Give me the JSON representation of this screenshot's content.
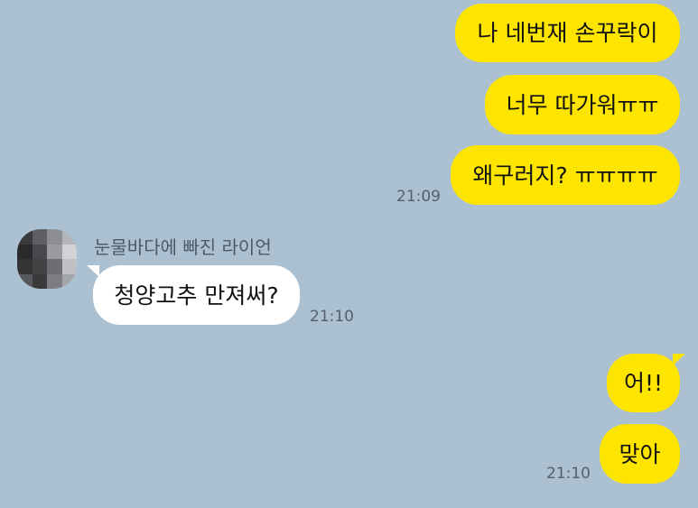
{
  "chat": {
    "outgoing_group_1": {
      "messages": [
        "나 네번재 손꾸락이",
        "너무 따가워ㅠㅠ",
        "왜구러지? ㅠㅠㅠㅠ"
      ],
      "time": "21:09"
    },
    "incoming": {
      "sender_name": "눈물바다에 빠진 라이언",
      "message": "청양고추 만져써?",
      "time": "21:10"
    },
    "outgoing_group_2": {
      "messages": [
        "어!!",
        "맞아"
      ],
      "time": "21:10"
    }
  },
  "colors": {
    "background": "#abc1d1",
    "outgoing_bubble": "#fee500",
    "incoming_bubble": "#ffffff",
    "timestamp": "#55606a"
  },
  "icons": {
    "avatar": "pixelated-profile-avatar"
  }
}
